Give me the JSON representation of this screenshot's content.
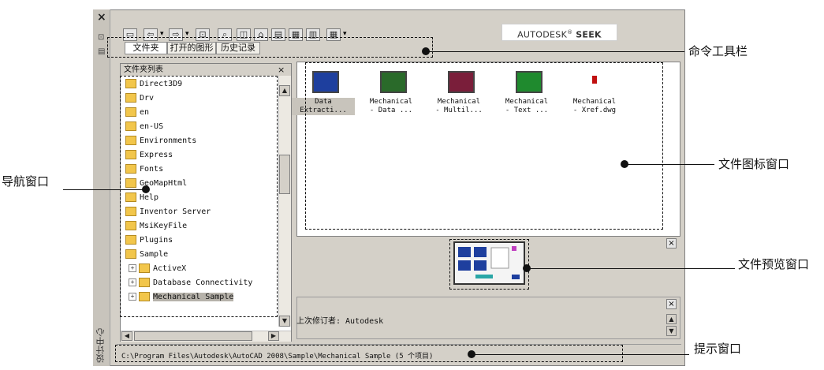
{
  "toolbar": {
    "seek_brand": "AUTODESK",
    "seek_reg": "®",
    "seek_word": "SEEK",
    "icons": [
      "load-icon",
      "back-icon",
      "forward-icon",
      "up-icon",
      "search-icon",
      "favorites-icon",
      "home-icon",
      "tree-toggle-icon",
      "preview-toggle-icon",
      "description-toggle-icon",
      "views-icon"
    ]
  },
  "tabs": [
    "文件夹",
    "打开的图形",
    "历史记录"
  ],
  "sidebar": {
    "close": "×",
    "title": "设计中心"
  },
  "folder_panel": {
    "title": "文件夹列表",
    "close": "×",
    "items": [
      {
        "label": "Direct3D9",
        "level": 0
      },
      {
        "label": "Drv",
        "level": 0
      },
      {
        "label": "en",
        "level": 0
      },
      {
        "label": "en-US",
        "level": 0
      },
      {
        "label": "Environments",
        "level": 0
      },
      {
        "label": "Express",
        "level": 0
      },
      {
        "label": "Fonts",
        "level": 0
      },
      {
        "label": "GeoMapHtml",
        "level": 0
      },
      {
        "label": "Help",
        "level": 0
      },
      {
        "label": "Inventor Server",
        "level": 0
      },
      {
        "label": "MsiKeyFile",
        "level": 0
      },
      {
        "label": "Plugins",
        "level": 0
      },
      {
        "label": "Sample",
        "level": 0
      },
      {
        "label": "ActiveX",
        "level": 1
      },
      {
        "label": "Database Connectivity",
        "level": 1
      },
      {
        "label": "Mechanical Sample",
        "level": 1,
        "selected": true
      }
    ]
  },
  "icon_panel": {
    "files": [
      {
        "line1": "Data",
        "line2": "Extracti...",
        "color": "#1e3f9e",
        "selected": true
      },
      {
        "line1": "Mechanical",
        "line2": "- Data ...",
        "color": "#2a6a2a"
      },
      {
        "line1": "Mechanical",
        "line2": "- Multil...",
        "color": "#7a1e3a"
      },
      {
        "line1": "Mechanical",
        "line2": "- Text ...",
        "color": "#1f8a2e"
      },
      {
        "line1": "Mechanical",
        "line2": "- Xref.dwg",
        "color": "#c01010"
      }
    ]
  },
  "preview_panel": {
    "close": "×"
  },
  "description_panel": {
    "text": "上次修订者: Autodesk",
    "close": "×"
  },
  "status_bar": {
    "path": "C:\\Program Files\\Autodesk\\AutoCAD 2008\\Sample\\Mechanical Sample (5 个项目)"
  },
  "callouts": {
    "toolbar": "命令工具栏",
    "icons": "文件图标窗口",
    "nav": "导航窗口",
    "preview": "文件预览窗口",
    "status": "提示窗口"
  }
}
